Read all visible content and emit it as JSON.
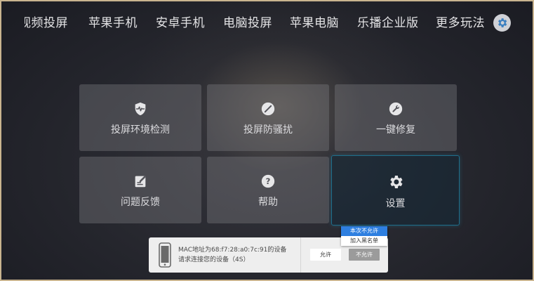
{
  "nav": {
    "items": [
      {
        "label": "视频投屏",
        "visible": "视频投屏"
      },
      {
        "label": "苹果手机"
      },
      {
        "label": "安卓手机"
      },
      {
        "label": "电脑投屏"
      },
      {
        "label": "苹果电脑"
      },
      {
        "label": "乐播企业版"
      },
      {
        "label": "更多玩法"
      }
    ],
    "settings_icon": "gear-icon"
  },
  "tiles": [
    {
      "label": "投屏环境检测",
      "icon": "shield-pulse-icon"
    },
    {
      "label": "投屏防骚扰",
      "icon": "no-disturb-icon"
    },
    {
      "label": "一键修复",
      "icon": "wrench-icon"
    },
    {
      "label": "问题反馈",
      "icon": "feedback-edit-icon"
    },
    {
      "label": "帮助",
      "icon": "help-icon"
    },
    {
      "label": "设置",
      "icon": "gear-icon",
      "selected": true
    }
  ],
  "dialog": {
    "icon": "phone-icon",
    "line1": "MAC地址为68:f7:28:a0:7c:91的设备",
    "line2": "请求连接您的设备（4S）",
    "allow_label": "允许",
    "deny_label": "不允许"
  },
  "deny_menu": {
    "options": [
      "本次不允许",
      "加入黑名单"
    ]
  },
  "colors": {
    "accent": "#1e6f8c",
    "popup_highlight": "#2e7fe0",
    "frame": "#c9b48f"
  }
}
